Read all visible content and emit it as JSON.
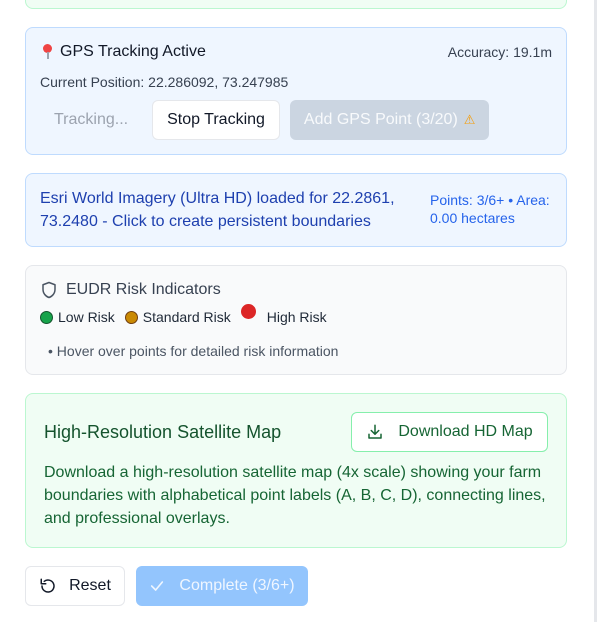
{
  "gps": {
    "title": "GPS Tracking Active",
    "accuracy": "Accuracy: 19.1m",
    "position": "Current Position: 22.286092, 73.247985",
    "tracking_label": "Tracking...",
    "stop_label": "Stop Tracking",
    "add_point_label": "Add GPS Point (3/20)",
    "icon": "map-pin-icon"
  },
  "esri": {
    "message": "Esri World Imagery (Ultra HD) loaded for 22.2861, 73.2480 - Click to create persistent boundaries",
    "points_area": "Points: 3/6+ • Area: 0.00 hectares"
  },
  "risk": {
    "title": "EUDR Risk Indicators",
    "legend": [
      {
        "label": "Low Risk",
        "color": "#16a34a"
      },
      {
        "label": "Standard Risk",
        "color": "#ca8a04"
      },
      {
        "label": "High Risk",
        "color": "#dc2626"
      }
    ],
    "note": "• Hover over points for detailed risk information"
  },
  "hd_map": {
    "title": "High-Resolution Satellite Map",
    "download_label": "Download HD Map",
    "description": "Download a high-resolution satellite map (4x scale) showing your farm boundaries with alphabetical point labels (A, B, C, D), connecting lines, and professional overlays."
  },
  "actions": {
    "reset_label": "Reset",
    "complete_label": "Complete (3/6+)"
  },
  "colors": {
    "info_bg": "#eff6ff",
    "success_bg": "#f0fdf4",
    "primary_disabled": "#93c5fd"
  }
}
